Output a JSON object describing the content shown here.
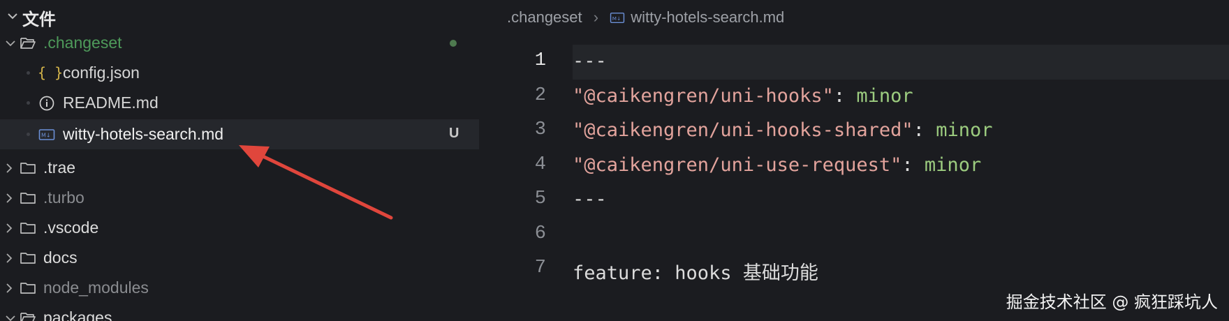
{
  "explorer": {
    "title": "文件",
    "items": [
      {
        "label": ".changeset",
        "type": "folder-open",
        "color": "#4e9a5a",
        "git": "dot"
      },
      {
        "label": "config.json",
        "type": "json",
        "braces": "{ }"
      },
      {
        "label": "README.md",
        "type": "info"
      },
      {
        "label": "witty-hotels-search.md",
        "type": "md",
        "git": "U",
        "selected": true
      },
      {
        "label": ".trae",
        "type": "folder"
      },
      {
        "label": ".turbo",
        "type": "folder",
        "dim": true
      },
      {
        "label": ".vscode",
        "type": "folder"
      },
      {
        "label": "docs",
        "type": "folder"
      },
      {
        "label": "node_modules",
        "type": "folder",
        "dim": true
      },
      {
        "label": "packages",
        "type": "folder-open"
      }
    ]
  },
  "breadcrumb": {
    "folder": ".changeset",
    "file": "witty-hotels-search.md"
  },
  "editor": {
    "lines": [
      {
        "n": "1",
        "parts": [
          {
            "t": "---",
            "c": "plain"
          }
        ]
      },
      {
        "n": "2",
        "parts": [
          {
            "t": "\"@caikengren/uni-hooks\"",
            "c": "str"
          },
          {
            "t": ": ",
            "c": "plain"
          },
          {
            "t": "minor",
            "c": "val"
          }
        ]
      },
      {
        "n": "3",
        "parts": [
          {
            "t": "\"@caikengren/uni-hooks-shared\"",
            "c": "str"
          },
          {
            "t": ": ",
            "c": "plain"
          },
          {
            "t": "minor",
            "c": "val"
          }
        ]
      },
      {
        "n": "4",
        "parts": [
          {
            "t": "\"@caikengren/uni-use-request\"",
            "c": "str"
          },
          {
            "t": ": ",
            "c": "plain"
          },
          {
            "t": "minor",
            "c": "val"
          }
        ]
      },
      {
        "n": "5",
        "parts": [
          {
            "t": "---",
            "c": "plain"
          }
        ]
      },
      {
        "n": "6",
        "parts": []
      },
      {
        "n": "7",
        "parts": [
          {
            "t": "feature: hooks 基础功能",
            "c": "plain"
          }
        ]
      }
    ]
  },
  "watermark": "掘金技术社区 @ 疯狂踩坑人",
  "colors": {
    "background": "#1b1c20",
    "selected_row": "#25272c",
    "string": "#e2a39c",
    "value": "#9ccc7f",
    "arrow": "#e0463c",
    "changeset_folder": "#4e9a5a"
  }
}
